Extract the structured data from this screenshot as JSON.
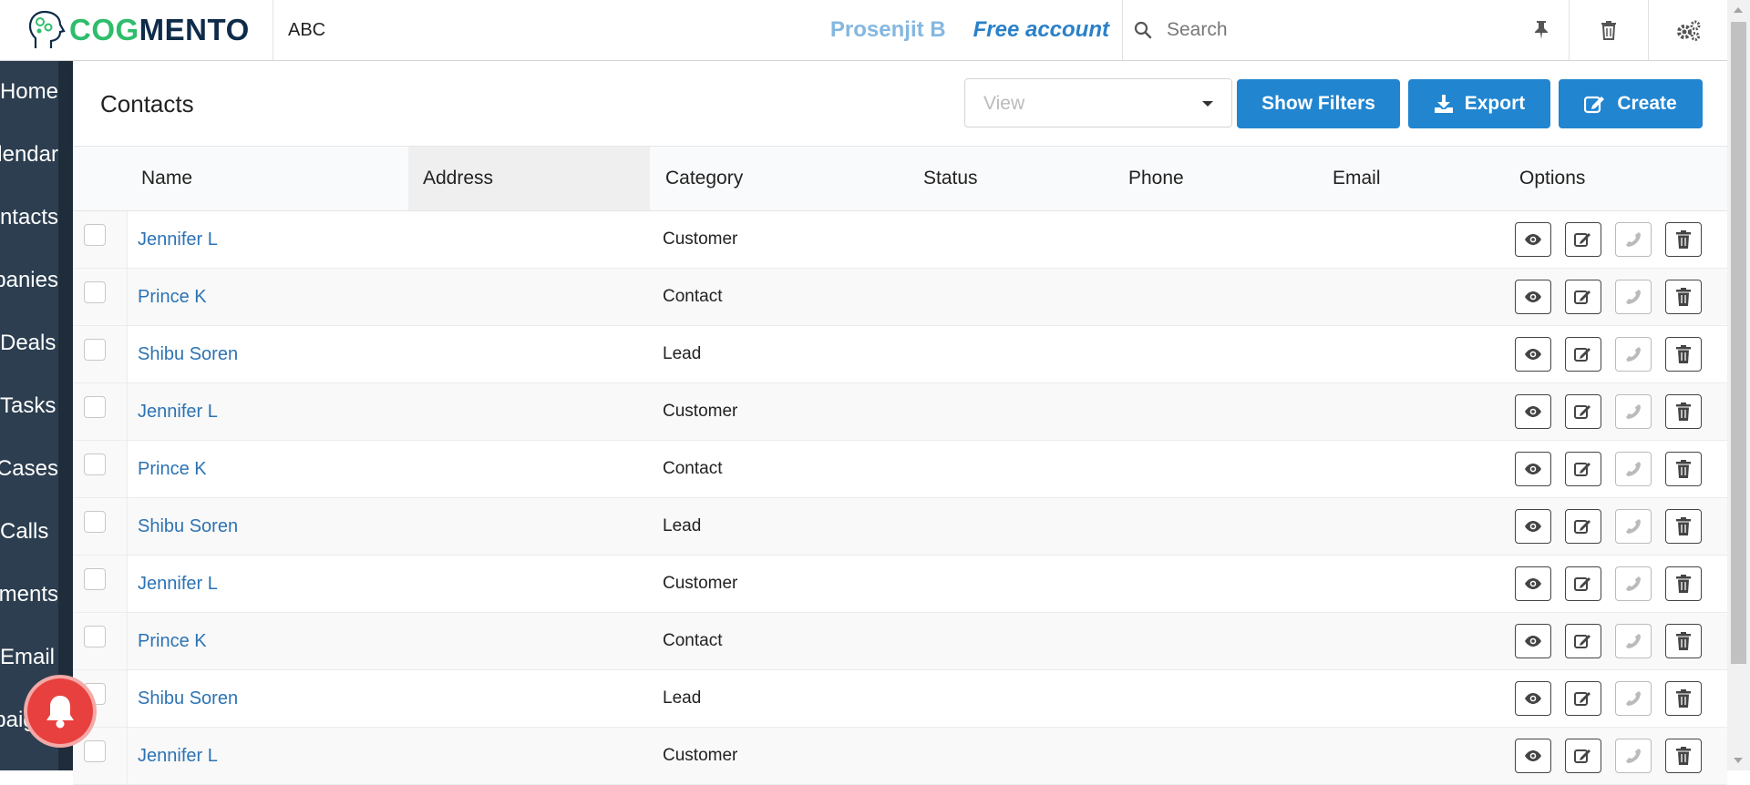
{
  "topbar": {
    "brand_cog": "COG",
    "brand_mento": "MENTO",
    "org_name": "ABC",
    "user_name": "Prosenjit B",
    "account_type": "Free account",
    "search_placeholder": "Search"
  },
  "sidebar": {
    "items": [
      {
        "label": "Home"
      },
      {
        "label": "Calendar"
      },
      {
        "label": "Contacts"
      },
      {
        "label": "Companies"
      },
      {
        "label": "Deals"
      },
      {
        "label": "Tasks"
      },
      {
        "label": "Cases"
      },
      {
        "label": "Calls"
      },
      {
        "label": "Documents"
      },
      {
        "label": "Email"
      },
      {
        "label": "Campaigns"
      }
    ]
  },
  "main": {
    "title": "Contacts",
    "view_placeholder": "View",
    "show_filters_label": "Show Filters",
    "export_label": "Export",
    "create_label": "Create"
  },
  "table": {
    "columns": [
      "Name",
      "Address",
      "Category",
      "Status",
      "Phone",
      "Email",
      "Options"
    ],
    "rows": [
      {
        "name": "Jennifer L",
        "category": "Customer"
      },
      {
        "name": "Prince K",
        "category": "Contact"
      },
      {
        "name": "Shibu Soren",
        "category": "Lead"
      },
      {
        "name": "Jennifer L",
        "category": "Customer"
      },
      {
        "name": "Prince K",
        "category": "Contact"
      },
      {
        "name": "Shibu Soren",
        "category": "Lead"
      },
      {
        "name": "Jennifer L",
        "category": "Customer"
      },
      {
        "name": "Prince K",
        "category": "Contact"
      },
      {
        "name": "Shibu Soren",
        "category": "Lead"
      },
      {
        "name": "Jennifer L",
        "category": "Customer"
      }
    ],
    "row_options": [
      "eye-icon",
      "edit-icon",
      "phone-icon",
      "trash-icon"
    ]
  },
  "colors": {
    "primary_blue": "#2185d0",
    "sidebar_bg": "#2c3e50",
    "brand_green": "#2ebd6b",
    "link_blue": "#2c73b3",
    "bell_red": "#e8403e"
  }
}
